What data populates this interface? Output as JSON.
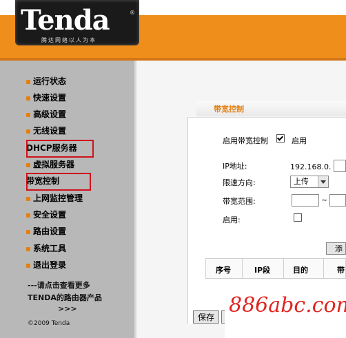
{
  "header": {
    "logo_text": "Tenda",
    "logo_reg": "®",
    "slogan": "腾达网络以人为本"
  },
  "sidebar": {
    "items": [
      {
        "label": "运行状态"
      },
      {
        "label": "快速设置"
      },
      {
        "label": "高级设置"
      },
      {
        "label": "无线设置"
      },
      {
        "label": "DHCP服务器"
      },
      {
        "label": "虚拟服务器"
      },
      {
        "label": "带宽控制"
      },
      {
        "label": "上网监控管理"
      },
      {
        "label": "安全设置"
      },
      {
        "label": "路由设置"
      },
      {
        "label": "系统工具"
      },
      {
        "label": "退出登录"
      }
    ],
    "promo_line1": "---请点击查看更多",
    "promo_line2": "TENDA的路由器产品",
    "promo_arrow": ">>>",
    "copyright": "©2009 Tenda"
  },
  "panel": {
    "title": "带宽控制",
    "enable_bw_label": "启用带宽控制",
    "enable_bw_checked": true,
    "enable_bw_text": "启用",
    "ip_label": "IP地址:",
    "ip_prefix": "192.168.0.",
    "direction_label": "限速方向:",
    "direction_value": "上传",
    "range_label": "带宽范围:",
    "range_sep": "~",
    "enable_label": "启用:",
    "enable_checked": false,
    "add_button": "添",
    "table_headers": [
      "序号",
      "IP段",
      "目的",
      "带"
    ],
    "save_button": "保存",
    "cancel_button": ""
  },
  "watermark": "886abc.com"
}
